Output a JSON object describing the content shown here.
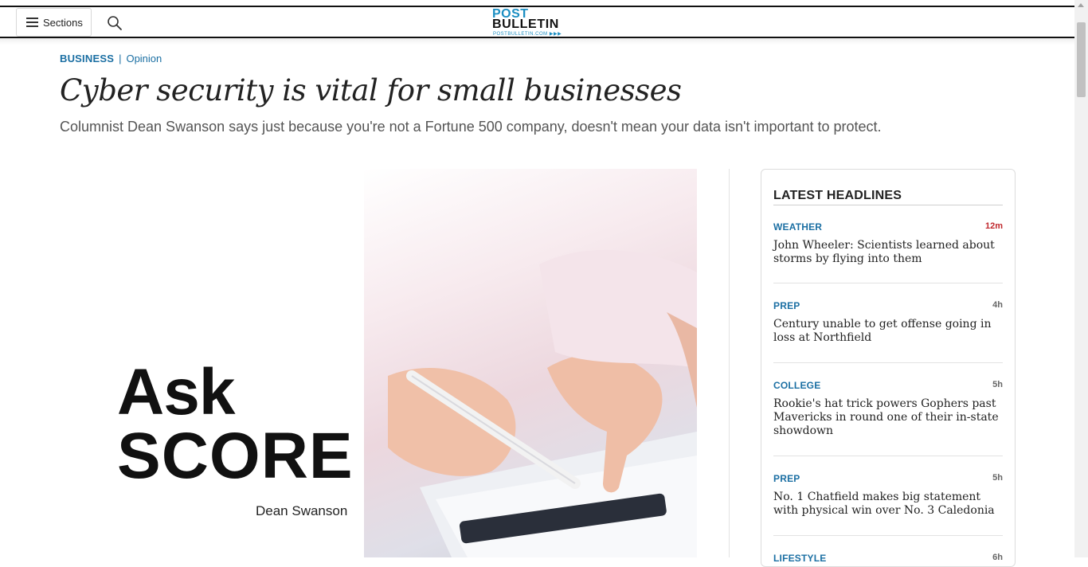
{
  "header": {
    "sections_label": "Sections",
    "logo": {
      "line1": "POST",
      "line2": "BULLETIN",
      "line3": "POSTBULLETIN.COM"
    }
  },
  "article": {
    "category": "BUSINESS",
    "separator": "|",
    "subcategory": "Opinion",
    "headline": "Cyber security is vital for small businesses",
    "deck": "Columnist Dean Swanson says just because you're not a Fortune 500 company, doesn't mean your data isn't important to protect.",
    "hero": {
      "line1": "Ask",
      "line2": "SCORE",
      "author": "Dean Swanson"
    }
  },
  "sidebar": {
    "title": "LATEST HEADLINES",
    "items": [
      {
        "category": "WEATHER",
        "time": "12m",
        "title": "John Wheeler: Scientists learned about storms by flying into them"
      },
      {
        "category": "PREP",
        "time": "4h",
        "title": "Century unable to get offense going in loss at Northfield"
      },
      {
        "category": "COLLEGE",
        "time": "5h",
        "title": "Rookie's hat trick powers Gophers past Mavericks in round one of their in-state showdown"
      },
      {
        "category": "PREP",
        "time": "5h",
        "title": "No. 1 Chatfield makes big statement with physical win over No. 3 Caledonia"
      },
      {
        "category": "LIFESTYLE",
        "time": "6h",
        "title": ""
      }
    ]
  },
  "colors": {
    "accent": "#1b6fa3",
    "fresh_time": "#c0282d",
    "logo_blue": "#1b8ec2"
  },
  "icons": {
    "menu": "hamburger-icon",
    "search": "search-icon"
  }
}
